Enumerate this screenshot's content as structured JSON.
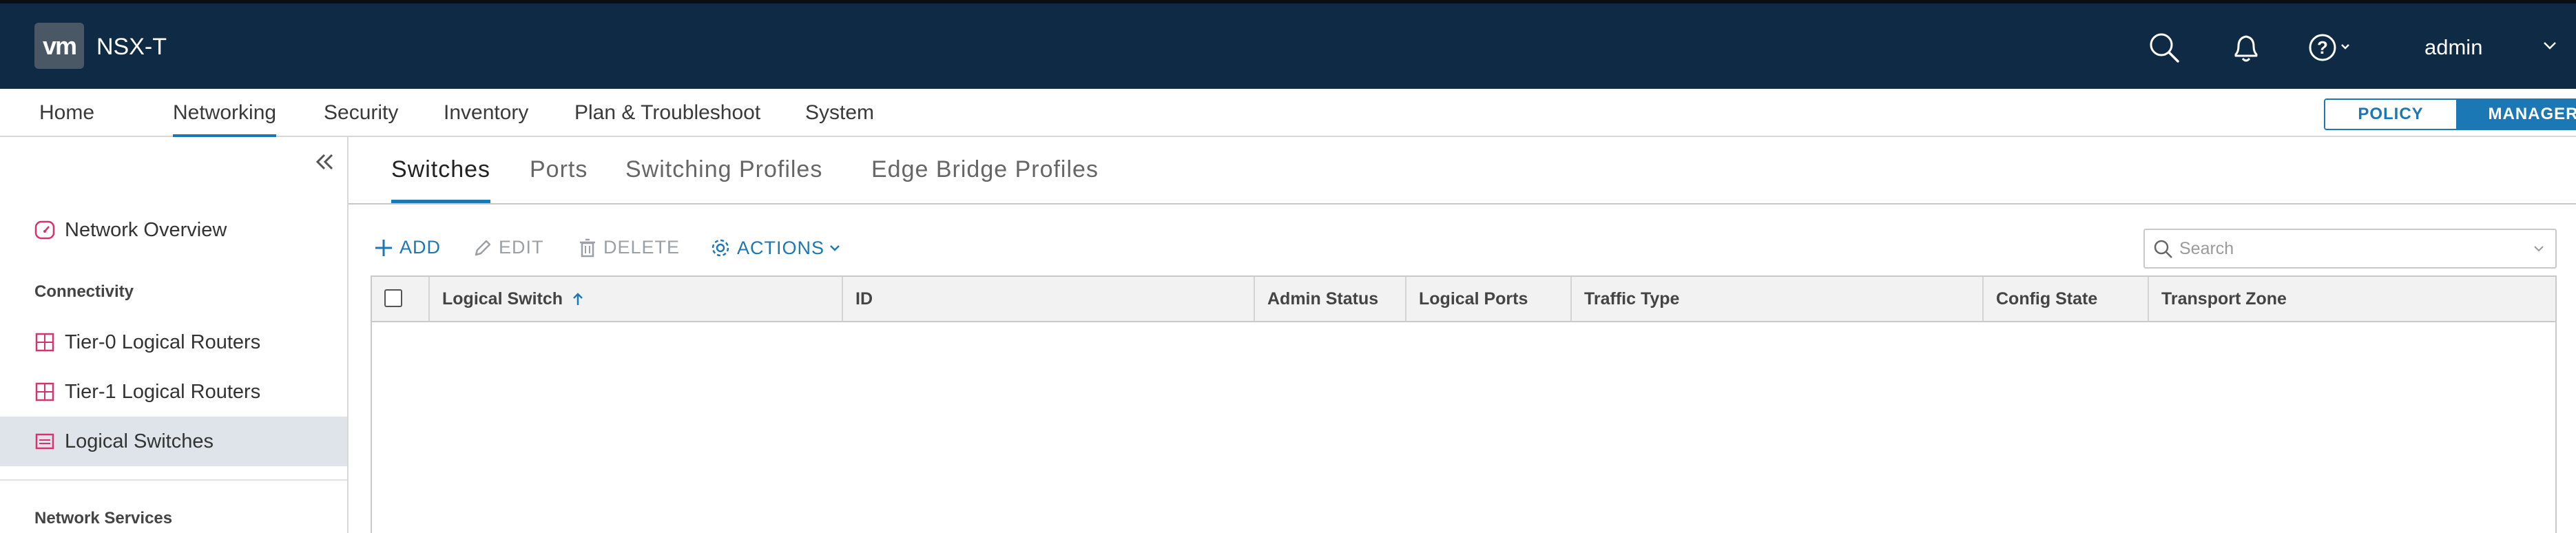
{
  "header": {
    "logo_text": "vm",
    "app_title": "NSX-T",
    "user": "admin",
    "icons": [
      "search-icon",
      "bell-icon",
      "help-icon",
      "chevron-down-icon"
    ],
    "bg_color": "#0e2a45"
  },
  "topnav": {
    "items": [
      {
        "label": "Home"
      },
      {
        "label": "Networking",
        "active": true
      },
      {
        "label": "Security"
      },
      {
        "label": "Inventory"
      },
      {
        "label": "Plan & Troubleshoot"
      },
      {
        "label": "System"
      }
    ],
    "mode_toggle": {
      "policy": "POLICY",
      "manager": "MANAGER",
      "selected": "MANAGER"
    }
  },
  "sidebar": {
    "items": [
      {
        "label": "Network Overview",
        "icon": "gauge-icon"
      },
      {
        "label": "Tier-0 Logical Routers",
        "icon": "router-icon"
      },
      {
        "label": "Tier-1 Logical Routers",
        "icon": "router-icon"
      },
      {
        "label": "Logical Switches",
        "icon": "switch-icon",
        "selected": true
      }
    ],
    "sections": {
      "connectivity": "Connectivity",
      "network_services": "Network Services"
    }
  },
  "tabs": [
    {
      "label": "Switches",
      "active": true
    },
    {
      "label": "Ports"
    },
    {
      "label": "Switching Profiles"
    },
    {
      "label": "Edge Bridge Profiles"
    }
  ],
  "toolbar": {
    "add": "ADD",
    "edit": "EDIT",
    "delete": "DELETE",
    "actions": "ACTIONS",
    "search_placeholder": "Search"
  },
  "grid": {
    "columns": [
      "Logical Switch",
      "ID",
      "Admin Status",
      "Logical Ports",
      "Traffic Type",
      "Config State",
      "Transport Zone"
    ],
    "sort_column": "Logical Switch",
    "sort_direction": "ascending",
    "rows": []
  },
  "colors": {
    "accent": "#1c78b4",
    "router_icon": "#d6336c"
  }
}
